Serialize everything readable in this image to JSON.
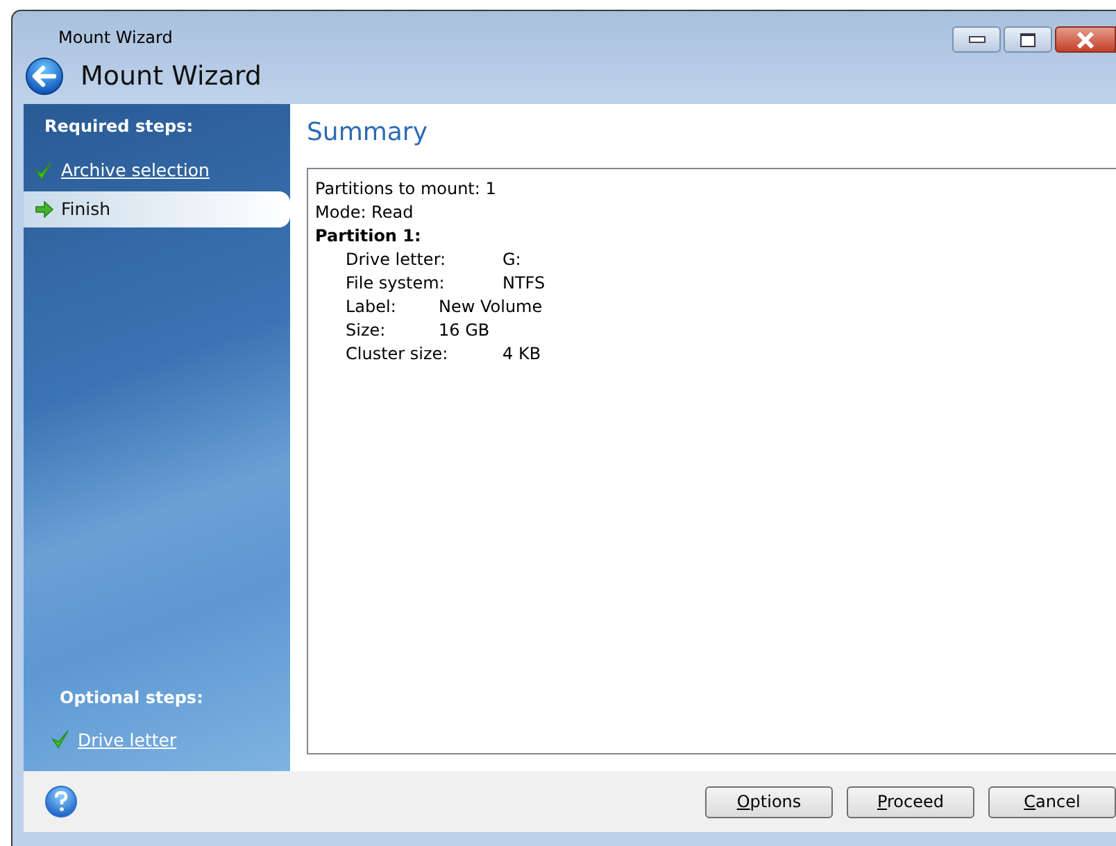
{
  "window": {
    "title": "Mount Wizard",
    "header": "Mount Wizard"
  },
  "sidebar": {
    "required_heading": "Required steps:",
    "required_steps": [
      {
        "label": "Archive selection",
        "kind": "done",
        "selected": false
      },
      {
        "label": "Finish",
        "kind": "current",
        "selected": true
      }
    ],
    "optional_heading": "Optional steps:",
    "optional_steps": [
      {
        "label": "Drive letter",
        "kind": "done",
        "selected": false
      }
    ]
  },
  "page_title": "Summary",
  "summary": [
    {
      "kind": "line",
      "text": "Partitions to mount: 1"
    },
    {
      "kind": "line",
      "text": "Mode: Read"
    },
    {
      "kind": "heading",
      "text": "Partition 1:"
    },
    {
      "kind": "field",
      "label": "Drive letter:",
      "value": "G:"
    },
    {
      "kind": "field",
      "label": "File system:",
      "value": "NTFS"
    },
    {
      "kind": "field",
      "label": "Label:",
      "value": "New Volume"
    },
    {
      "kind": "field",
      "label": "Size:",
      "value": "16 GB"
    },
    {
      "kind": "field",
      "label": "Cluster size:",
      "value": "4 KB"
    }
  ],
  "buttons": [
    {
      "mnemonic": "O",
      "rest": "ptions"
    },
    {
      "mnemonic": "P",
      "rest": "roceed"
    },
    {
      "mnemonic": "C",
      "rest": "ancel"
    }
  ]
}
